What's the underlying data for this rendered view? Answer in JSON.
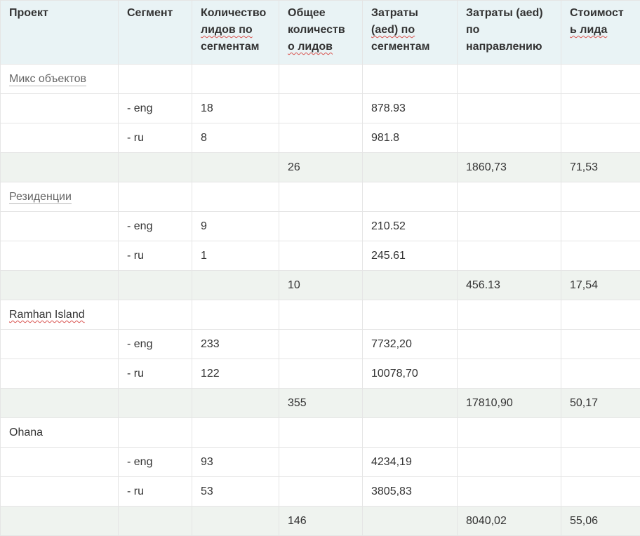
{
  "headers": {
    "project": "Проект",
    "segment": "Сегмент",
    "leads_by_segment": [
      "Количество",
      "лидов по",
      "сегментам"
    ],
    "leads_total": [
      "Общее",
      "количеств",
      "о лидов"
    ],
    "cost_by_segment": [
      "Затраты",
      "(aed) по",
      "сегментам"
    ],
    "cost_by_direction": [
      "Затраты (aed)",
      "по",
      "направлению"
    ],
    "cost_per_lead": [
      "Стоимост",
      "ь лида"
    ]
  },
  "projects": [
    {
      "name": "Микс объектов",
      "segments": [
        {
          "seg": "- eng",
          "leads": "18",
          "cost": "878.93"
        },
        {
          "seg": "- ru",
          "leads": "8",
          "cost": "981.8"
        }
      ],
      "total": {
        "leads": "26",
        "cost": "1860,73",
        "per_lead": "71,53"
      }
    },
    {
      "name": "Резиденции",
      "segments": [
        {
          "seg": "- eng",
          "leads": "9",
          "cost": "210.52"
        },
        {
          "seg": "- ru",
          "leads": "1",
          "cost": "245.61"
        }
      ],
      "total": {
        "leads": "10",
        "cost": "456.13",
        "per_lead": "17,54"
      }
    },
    {
      "name": "Ramhan Island",
      "segments": [
        {
          "seg": "- eng",
          "leads": "233",
          "cost": "7732,20"
        },
        {
          "seg": "- ru",
          "leads": "122",
          "cost": "10078,70"
        }
      ],
      "total": {
        "leads": "355",
        "cost": "17810,90",
        "per_lead": "50,17"
      }
    },
    {
      "name": "Ohana",
      "segments": [
        {
          "seg": "- eng",
          "leads": "93",
          "cost": "4234,19"
        },
        {
          "seg": "- ru",
          "leads": "53",
          "cost": "3805,83"
        }
      ],
      "total": {
        "leads": "146",
        "cost": "8040,02",
        "per_lead": "55,06"
      }
    }
  ]
}
